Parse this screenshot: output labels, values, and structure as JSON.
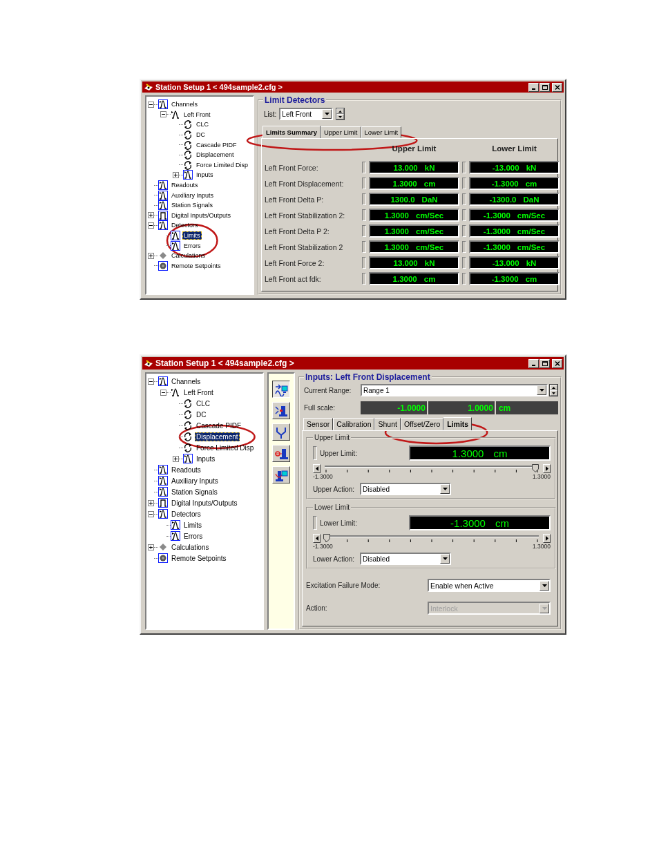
{
  "windows": [
    {
      "title": "Station Setup 1 < 494sample2.cfg >",
      "tree": [
        {
          "label": "Channels",
          "kind": "signal",
          "expanded": true,
          "selected": false,
          "circled": false,
          "children": [
            {
              "label": "Left Front",
              "kind": "signal-plain",
              "expanded": true,
              "selected": false,
              "circled": false,
              "children": [
                {
                  "label": "CLC",
                  "kind": "loop",
                  "selected": false,
                  "circled": false
                },
                {
                  "label": "DC",
                  "kind": "loop",
                  "selected": false,
                  "circled": false
                },
                {
                  "label": "Cascade PIDF",
                  "kind": "loop",
                  "selected": false,
                  "circled": false
                },
                {
                  "label": "Displacement",
                  "kind": "loop",
                  "selected": false,
                  "circled": false
                },
                {
                  "label": "Force Limited Disp",
                  "kind": "loop",
                  "selected": false,
                  "circled": false
                },
                {
                  "label": "Inputs",
                  "kind": "signal",
                  "expanded": false,
                  "selected": false,
                  "circled": false
                }
              ]
            }
          ]
        },
        {
          "label": "Readouts",
          "kind": "signal",
          "selected": false,
          "circled": false
        },
        {
          "label": "Auxiliary Inputs",
          "kind": "signal",
          "selected": false,
          "circled": false
        },
        {
          "label": "Station Signals",
          "kind": "signal",
          "selected": false,
          "circled": false
        },
        {
          "label": "Digital Inputs/Outputs",
          "kind": "pulse",
          "expanded": false,
          "selected": false,
          "circled": false
        },
        {
          "label": "Detectors",
          "kind": "signal",
          "expanded": true,
          "selected": false,
          "circled": false,
          "children": [
            {
              "label": "Limits",
              "kind": "signal",
              "selected": true,
              "circled": true
            },
            {
              "label": "Errors",
              "kind": "signal",
              "selected": false,
              "circled": true
            }
          ]
        },
        {
          "label": "Calculations",
          "kind": "diamond",
          "expanded": false,
          "selected": false,
          "circled": false
        },
        {
          "label": "Remote Setpoints",
          "kind": "setpoint",
          "selected": false,
          "circled": false
        }
      ],
      "panel": {
        "kind": "limit-summary",
        "title": "Limit Detectors",
        "list_label": "List:",
        "list_value": "Left Front",
        "tabs": [
          {
            "label": "Limits Summary",
            "selected": true,
            "circled": true
          },
          {
            "label": "Upper Limit",
            "selected": false,
            "circled": true
          },
          {
            "label": "Lower Limit",
            "selected": false,
            "circled": true
          }
        ],
        "columns": [
          "Upper Limit",
          "Lower Limit"
        ],
        "rows": [
          {
            "label": "Left Front Force:",
            "upper_value": "13.000",
            "upper_unit": "kN",
            "lower_value": "-13.000",
            "lower_unit": "kN"
          },
          {
            "label": "Left Front Displacement:",
            "upper_value": "1.3000",
            "upper_unit": "cm",
            "lower_value": "-1.3000",
            "lower_unit": "cm"
          },
          {
            "label": "Left Front Delta P:",
            "upper_value": "1300.0",
            "upper_unit": "DaN",
            "lower_value": "-1300.0",
            "lower_unit": "DaN"
          },
          {
            "label": "Left Front Stabilization 2:",
            "upper_value": "1.3000",
            "upper_unit": "cm/Sec",
            "lower_value": "-1.3000",
            "lower_unit": "cm/Sec"
          },
          {
            "label": "Left Front Delta P 2:",
            "upper_value": "1.3000",
            "upper_unit": "cm/Sec",
            "lower_value": "-1.3000",
            "lower_unit": "cm/Sec"
          },
          {
            "label": "Left Front Stabilization 2",
            "upper_value": "1.3000",
            "upper_unit": "cm/Sec",
            "lower_value": "-1.3000",
            "lower_unit": "cm/Sec"
          },
          {
            "label": "Left Front Force 2:",
            "upper_value": "13.000",
            "upper_unit": "kN",
            "lower_value": "-13.000",
            "lower_unit": "kN"
          },
          {
            "label": "Left Front act fdk:",
            "upper_value": "1.3000",
            "upper_unit": "cm",
            "lower_value": "-1.3000",
            "lower_unit": "cm"
          }
        ]
      }
    },
    {
      "title": "Station Setup 1 < 494sample2.cfg >",
      "tree": [
        {
          "label": "Channels",
          "kind": "signal",
          "expanded": true,
          "selected": false,
          "circled": false,
          "children": [
            {
              "label": "Left Front",
              "kind": "signal-plain",
              "expanded": true,
              "selected": false,
              "circled": false,
              "children": [
                {
                  "label": "CLC",
                  "kind": "loop",
                  "selected": false,
                  "circled": false
                },
                {
                  "label": "DC",
                  "kind": "loop",
                  "selected": false,
                  "circled": false
                },
                {
                  "label": "Cascade PIDF",
                  "kind": "loop",
                  "selected": false,
                  "circled": false
                },
                {
                  "label": "Displacement",
                  "kind": "loop",
                  "selected": true,
                  "circled": true
                },
                {
                  "label": "Force Limited Disp",
                  "kind": "loop",
                  "selected": false,
                  "circled": false
                },
                {
                  "label": "Inputs",
                  "kind": "signal",
                  "expanded": false,
                  "selected": false,
                  "circled": false
                }
              ]
            }
          ]
        },
        {
          "label": "Readouts",
          "kind": "signal",
          "selected": false,
          "circled": false
        },
        {
          "label": "Auxiliary Inputs",
          "kind": "signal",
          "selected": false,
          "circled": false
        },
        {
          "label": "Station Signals",
          "kind": "signal",
          "selected": false,
          "circled": false
        },
        {
          "label": "Digital Inputs/Outputs",
          "kind": "pulse",
          "expanded": false,
          "selected": false,
          "circled": false
        },
        {
          "label": "Detectors",
          "kind": "signal",
          "expanded": true,
          "selected": false,
          "circled": false,
          "children": [
            {
              "label": "Limits",
              "kind": "signal",
              "selected": false,
              "circled": false
            },
            {
              "label": "Errors",
              "kind": "signal",
              "selected": false,
              "circled": false
            }
          ]
        },
        {
          "label": "Calculations",
          "kind": "diamond",
          "expanded": false,
          "selected": false,
          "circled": false
        },
        {
          "label": "Remote Setpoints",
          "kind": "setpoint",
          "selected": false,
          "circled": false
        }
      ],
      "toolbar": [
        {
          "kind": "wave-monitor",
          "selected": true
        },
        {
          "kind": "actuator-arrows",
          "selected": false
        },
        {
          "kind": "fork",
          "selected": false
        },
        {
          "kind": "target-actuator",
          "selected": false
        },
        {
          "kind": "actuator-monitor",
          "selected": false
        }
      ],
      "panel": {
        "kind": "input-setup",
        "title": "Inputs: Left Front Displacement",
        "range_label": "Current Range:",
        "range_value": "Range 1",
        "scale_label": "Full scale:",
        "scale_min": "-1.0000",
        "scale_max": "1.0000",
        "scale_unit": "cm",
        "tabs": [
          {
            "label": "Sensor",
            "selected": false,
            "circled": false
          },
          {
            "label": "Calibration",
            "selected": false,
            "circled": false
          },
          {
            "label": "Shunt",
            "selected": false,
            "circled": false
          },
          {
            "label": "Offset/Zero",
            "selected": false,
            "circled": true
          },
          {
            "label": "Limits",
            "selected": true,
            "circled": true
          }
        ],
        "limits": [
          {
            "title": "Upper Limit",
            "label": "Upper Limit:",
            "value": "1.3000",
            "unit": "cm",
            "level": 1,
            "min_label": "-1.3000",
            "max_label": "1.3000",
            "action_label": "Upper Action:",
            "action_value": "Disabled"
          },
          {
            "title": "Lower Limit",
            "label": "Lower Limit:",
            "value": "-1.3000",
            "unit": "cm",
            "level": 0,
            "min_label": "-1.3000",
            "max_label": "1.3000",
            "action_label": "Lower Action:",
            "action_value": "Disabled"
          }
        ],
        "settings": [
          {
            "label": "Excitation Failure Mode:",
            "value": "Enable when Active",
            "disabled": false
          },
          {
            "label": "Action:",
            "value": "Interlock",
            "disabled": true
          }
        ]
      }
    }
  ]
}
